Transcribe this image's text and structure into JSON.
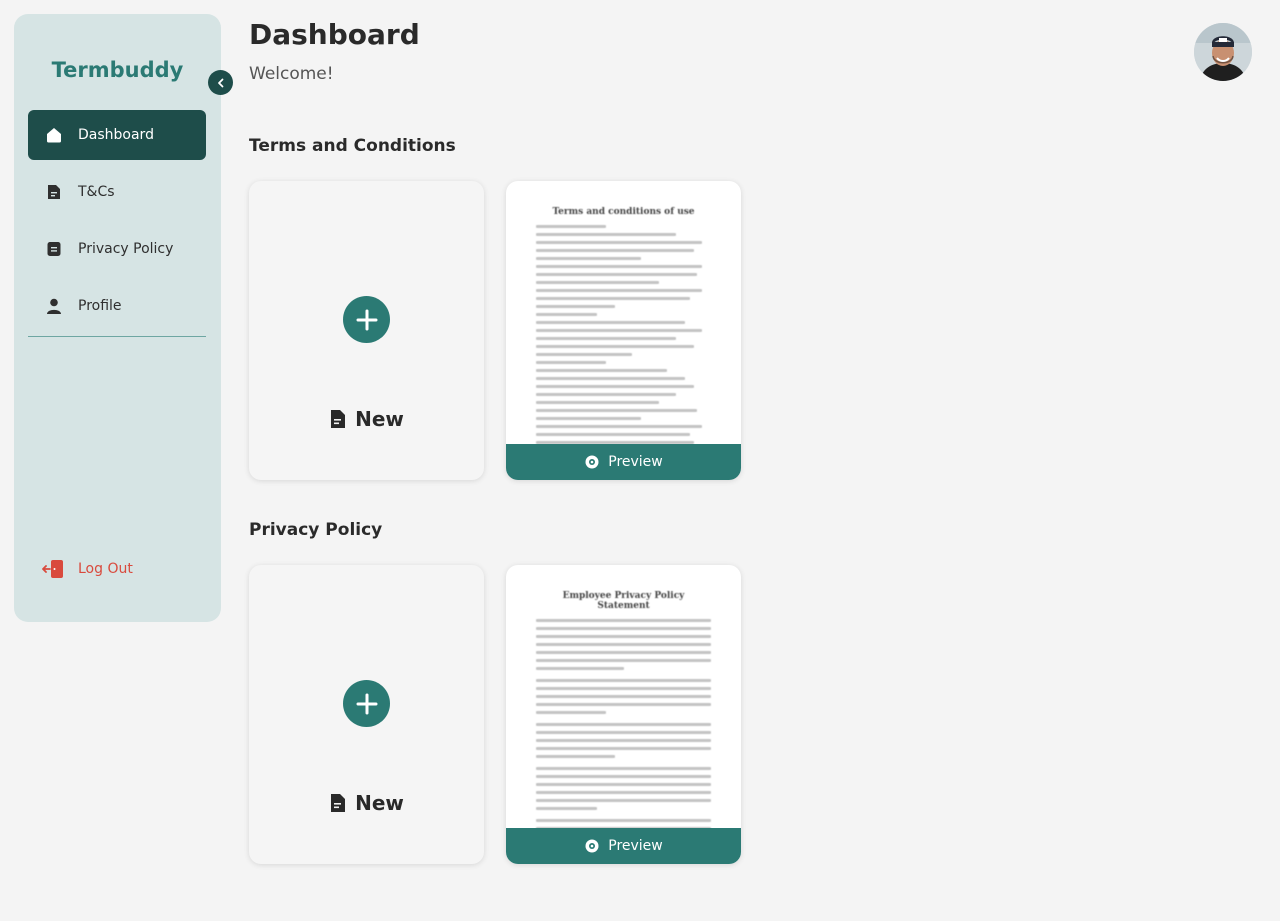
{
  "brand": "Termbuddy",
  "sidebar": {
    "items": [
      {
        "label": "Dashboard",
        "icon": "home-icon",
        "active": true
      },
      {
        "label": "T&Cs",
        "icon": "document-icon"
      },
      {
        "label": "Privacy Policy",
        "icon": "list-document-icon"
      },
      {
        "label": "Profile",
        "icon": "user-icon"
      }
    ],
    "logout_label": "Log Out"
  },
  "header": {
    "title": "Dashboard",
    "subtitle": "Welcome!"
  },
  "sections": {
    "terms": {
      "title": "Terms and Conditions",
      "new_label": "New",
      "doc_title": "Terms and conditions of use",
      "preview_label": "Preview"
    },
    "privacy": {
      "title": "Privacy Policy",
      "new_label": "New",
      "doc_title": "Employee Privacy Policy Statement",
      "preview_label": "Preview"
    }
  },
  "colors": {
    "accent": "#2b7a74",
    "accent_dark": "#1e4d4a",
    "sidebar_bg": "#d6e4e4",
    "danger": "#d94a3d"
  }
}
